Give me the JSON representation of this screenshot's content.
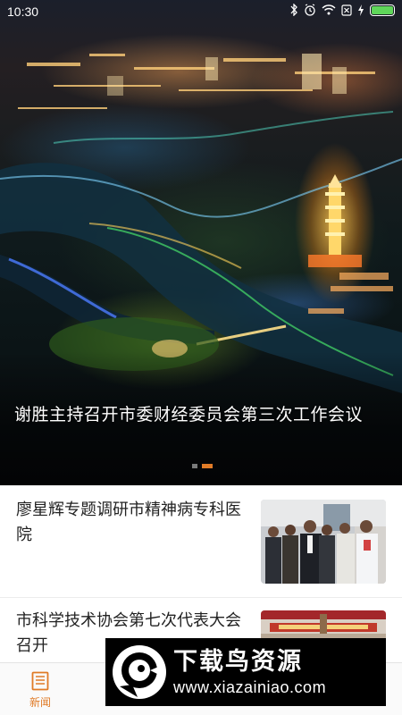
{
  "status_bar": {
    "time": "10:30",
    "icons": [
      "bluetooth-icon",
      "alarm-icon",
      "wifi-icon",
      "sim-off-icon",
      "charging-icon",
      "battery-icon"
    ],
    "battery_level": 1.0
  },
  "carousel": {
    "slides": [
      {
        "title": "谢胜主持召开市委财经委员会第三次工作会议"
      }
    ],
    "slide_count": 2,
    "active_index": 1,
    "accent_color": "#e07b27"
  },
  "news": [
    {
      "title": "廖星辉专题调研市精神病专科医院"
    },
    {
      "title": "市科学技术协会第七次代表大会召开"
    }
  ],
  "bottom_nav": {
    "tabs": [
      {
        "label": "新闻",
        "icon": "newspaper-icon",
        "active": true
      }
    ],
    "active_color": "#e07b27"
  },
  "watermark": {
    "brand": "下载鸟资源",
    "url": "www.xiazainiao.com"
  }
}
